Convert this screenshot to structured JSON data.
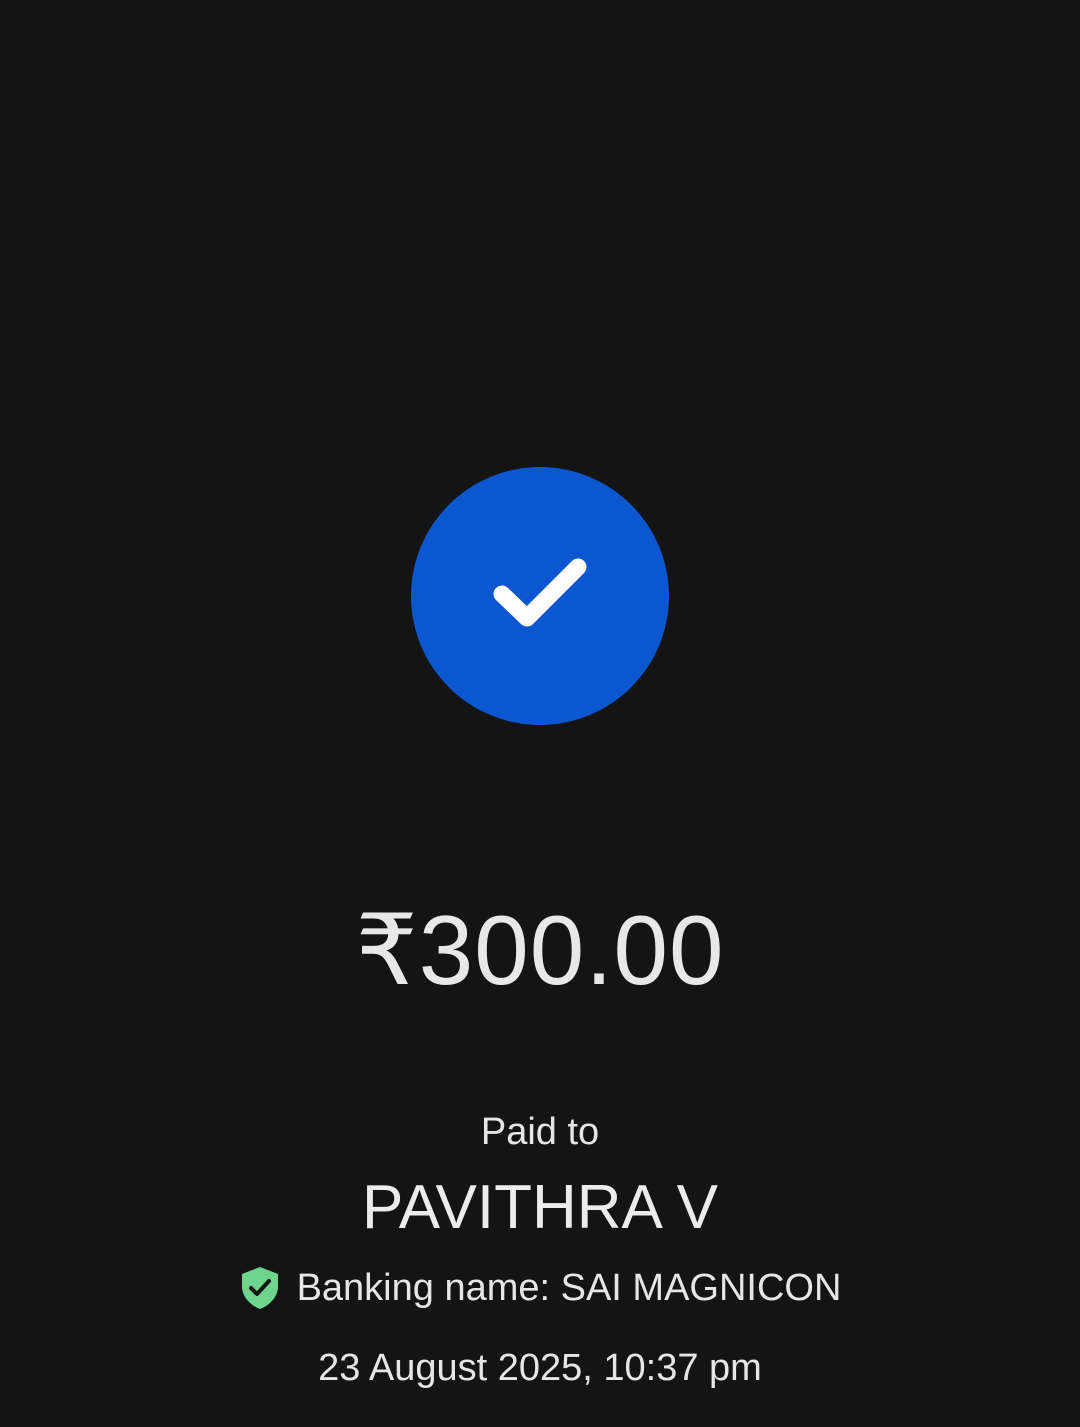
{
  "colors": {
    "background": "#141414",
    "success_badge": "#0b57d0",
    "verified_shield": "#6dd58c",
    "text": "#e8e8e8"
  },
  "icons": {
    "status": "check-icon",
    "verified": "verified-shield-icon"
  },
  "payment": {
    "amount": "₹300.00",
    "paid_to_label": "Paid to",
    "payee_name": "PAVITHRA V",
    "banking_name": "Banking name: SAI MAGNICON",
    "timestamp": "23 August 2025, 10:37 pm"
  }
}
